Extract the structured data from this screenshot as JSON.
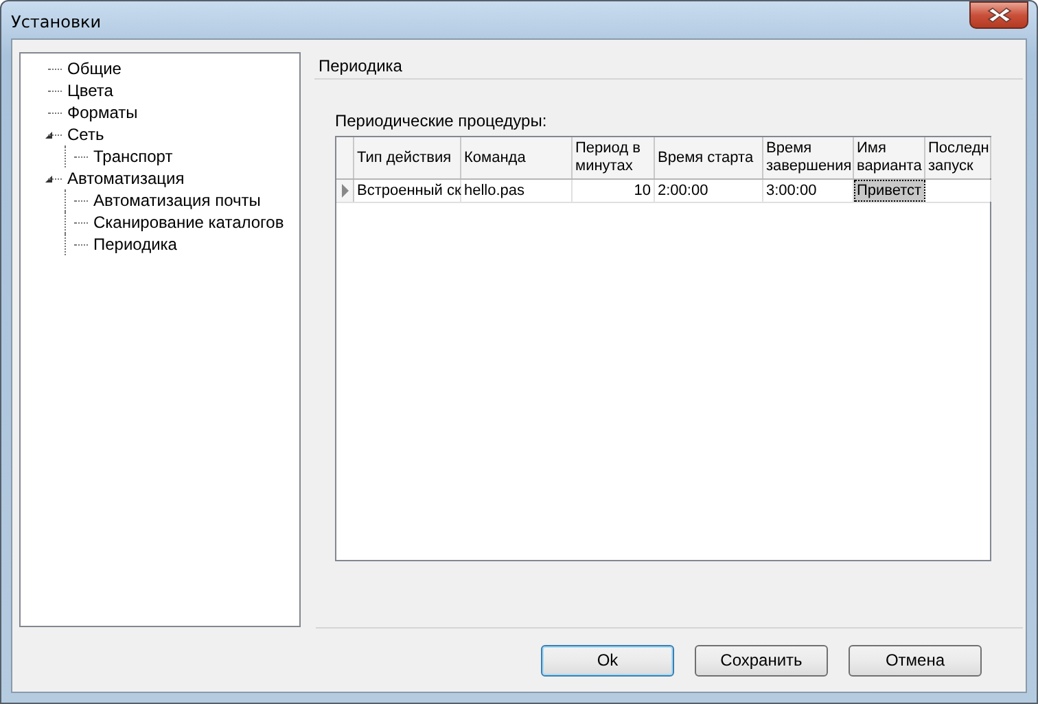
{
  "window": {
    "title": "Установки"
  },
  "tree": [
    {
      "label": "Общие",
      "selected": false
    },
    {
      "label": "Цвета",
      "selected": false
    },
    {
      "label": "Форматы",
      "selected": false
    },
    {
      "label": "Сеть",
      "selected": false,
      "expanded": true,
      "children": [
        {
          "label": "Транспорт",
          "selected": false
        }
      ]
    },
    {
      "label": "Автоматизация",
      "selected": false,
      "expanded": true,
      "children": [
        {
          "label": "Автоматизация почты",
          "selected": false
        },
        {
          "label": "Сканирование каталогов",
          "selected": false
        },
        {
          "label": "Периодика",
          "selected": false
        }
      ]
    }
  ],
  "page": {
    "title": "Периодика",
    "grid_label": "Периодические процедуры:"
  },
  "table": {
    "columns": [
      "Тип действия",
      "Команда",
      "Период в минутах",
      "Время старта",
      "Время завершения",
      "Имя варианта",
      "Последн запуск"
    ],
    "rows": [
      {
        "current": true,
        "cells": [
          {
            "text": "Встроенный ск",
            "selected": false
          },
          {
            "text": "hello.pas",
            "selected": false
          },
          {
            "text": "10",
            "selected": false
          },
          {
            "text": "2:00:00",
            "selected": false
          },
          {
            "text": "3:00:00",
            "selected": false
          },
          {
            "text": "Приветст",
            "selected": true
          },
          {
            "selected": false
          }
        ]
      }
    ]
  },
  "buttons": [
    {
      "label": "Ok",
      "default": true
    },
    {
      "label": "Сохранить",
      "default": false
    },
    {
      "label": "Отмена",
      "default": false
    }
  ]
}
